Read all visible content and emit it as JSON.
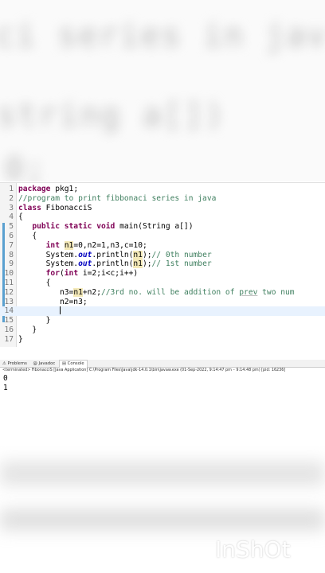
{
  "blur_text": [
    "ci series in jav",
    "string a[])",
    "0;"
  ],
  "code": {
    "lines": [
      {
        "n": "1",
        "t": "package pkg1;"
      },
      {
        "n": "2",
        "t": "//program to print fibbonaci series in java"
      },
      {
        "n": "3",
        "t": "class FibonacciS"
      },
      {
        "n": "4",
        "t": "{"
      },
      {
        "n": "5",
        "t": "public static void main(String a[])"
      },
      {
        "n": "6",
        "t": "{"
      },
      {
        "n": "7",
        "t": "int n1=0,n2=1,n3,c=10;"
      },
      {
        "n": "8",
        "t": "System.out.println(n1);// 0th number"
      },
      {
        "n": "9",
        "t": "System.out.println(n1);// 1st number"
      },
      {
        "n": "10",
        "t": "for(int i=2;i<c;i++)"
      },
      {
        "n": "11",
        "t": "{"
      },
      {
        "n": "12",
        "t": "n3=n1+n2;//3rd no. will be addition of prev two num"
      },
      {
        "n": "13",
        "t": "n2=n3;"
      },
      {
        "n": "14",
        "t": ""
      },
      {
        "n": "15",
        "t": "}"
      },
      {
        "n": "16",
        "t": "}"
      },
      {
        "n": "17",
        "t": "}"
      }
    ]
  },
  "panel": {
    "tabs": [
      "Problems",
      "Javadoc",
      "Console"
    ],
    "terminated": "<terminated> FibonacciS [Java Application] C:\\Program Files\\Java\\jdk-14.0.1\\bin\\javaw.exe  (01-Sep-2022, 9:14:47 pm – 9:14:48 pm) [pid: 16236]",
    "output": [
      "0",
      "1"
    ]
  },
  "watermark": "InShOt"
}
